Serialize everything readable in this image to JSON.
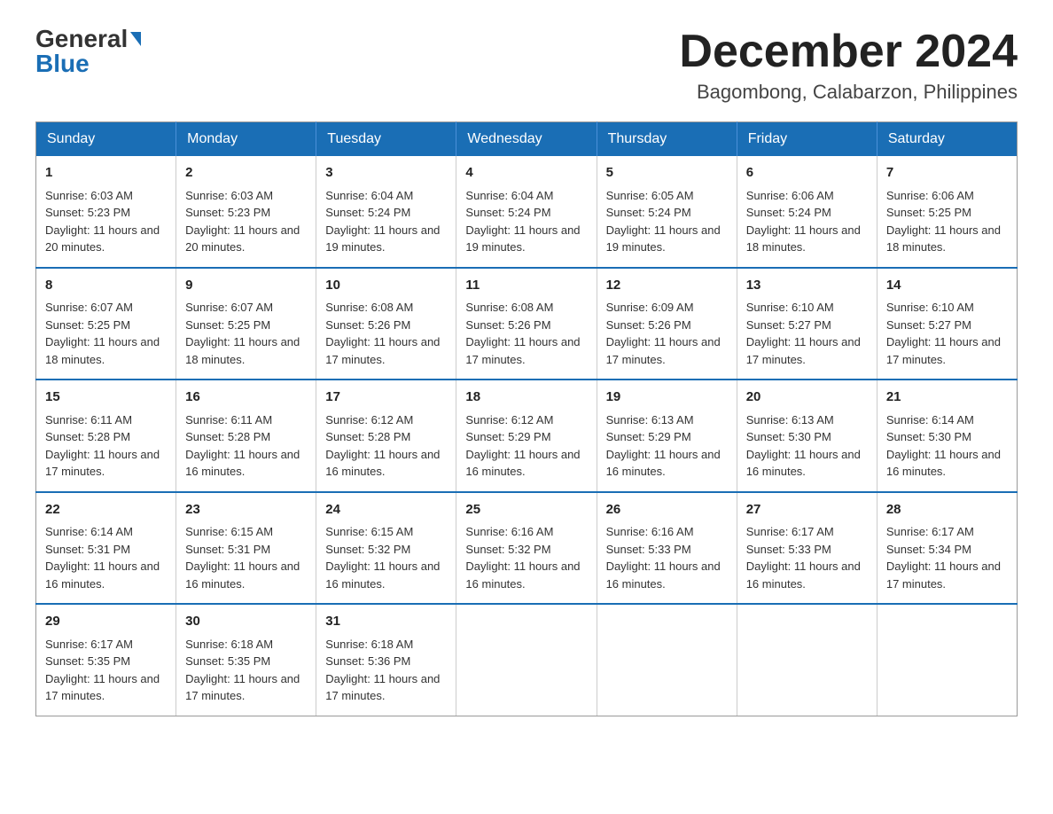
{
  "header": {
    "logo_general": "General",
    "logo_blue": "Blue",
    "month_title": "December 2024",
    "location": "Bagombong, Calabarzon, Philippines"
  },
  "days_of_week": [
    "Sunday",
    "Monday",
    "Tuesday",
    "Wednesday",
    "Thursday",
    "Friday",
    "Saturday"
  ],
  "weeks": [
    [
      {
        "day": "1",
        "sunrise": "6:03 AM",
        "sunset": "5:23 PM",
        "daylight": "11 hours and 20 minutes."
      },
      {
        "day": "2",
        "sunrise": "6:03 AM",
        "sunset": "5:23 PM",
        "daylight": "11 hours and 20 minutes."
      },
      {
        "day": "3",
        "sunrise": "6:04 AM",
        "sunset": "5:24 PM",
        "daylight": "11 hours and 19 minutes."
      },
      {
        "day": "4",
        "sunrise": "6:04 AM",
        "sunset": "5:24 PM",
        "daylight": "11 hours and 19 minutes."
      },
      {
        "day": "5",
        "sunrise": "6:05 AM",
        "sunset": "5:24 PM",
        "daylight": "11 hours and 19 minutes."
      },
      {
        "day": "6",
        "sunrise": "6:06 AM",
        "sunset": "5:24 PM",
        "daylight": "11 hours and 18 minutes."
      },
      {
        "day": "7",
        "sunrise": "6:06 AM",
        "sunset": "5:25 PM",
        "daylight": "11 hours and 18 minutes."
      }
    ],
    [
      {
        "day": "8",
        "sunrise": "6:07 AM",
        "sunset": "5:25 PM",
        "daylight": "11 hours and 18 minutes."
      },
      {
        "day": "9",
        "sunrise": "6:07 AM",
        "sunset": "5:25 PM",
        "daylight": "11 hours and 18 minutes."
      },
      {
        "day": "10",
        "sunrise": "6:08 AM",
        "sunset": "5:26 PM",
        "daylight": "11 hours and 17 minutes."
      },
      {
        "day": "11",
        "sunrise": "6:08 AM",
        "sunset": "5:26 PM",
        "daylight": "11 hours and 17 minutes."
      },
      {
        "day": "12",
        "sunrise": "6:09 AM",
        "sunset": "5:26 PM",
        "daylight": "11 hours and 17 minutes."
      },
      {
        "day": "13",
        "sunrise": "6:10 AM",
        "sunset": "5:27 PM",
        "daylight": "11 hours and 17 minutes."
      },
      {
        "day": "14",
        "sunrise": "6:10 AM",
        "sunset": "5:27 PM",
        "daylight": "11 hours and 17 minutes."
      }
    ],
    [
      {
        "day": "15",
        "sunrise": "6:11 AM",
        "sunset": "5:28 PM",
        "daylight": "11 hours and 17 minutes."
      },
      {
        "day": "16",
        "sunrise": "6:11 AM",
        "sunset": "5:28 PM",
        "daylight": "11 hours and 16 minutes."
      },
      {
        "day": "17",
        "sunrise": "6:12 AM",
        "sunset": "5:28 PM",
        "daylight": "11 hours and 16 minutes."
      },
      {
        "day": "18",
        "sunrise": "6:12 AM",
        "sunset": "5:29 PM",
        "daylight": "11 hours and 16 minutes."
      },
      {
        "day": "19",
        "sunrise": "6:13 AM",
        "sunset": "5:29 PM",
        "daylight": "11 hours and 16 minutes."
      },
      {
        "day": "20",
        "sunrise": "6:13 AM",
        "sunset": "5:30 PM",
        "daylight": "11 hours and 16 minutes."
      },
      {
        "day": "21",
        "sunrise": "6:14 AM",
        "sunset": "5:30 PM",
        "daylight": "11 hours and 16 minutes."
      }
    ],
    [
      {
        "day": "22",
        "sunrise": "6:14 AM",
        "sunset": "5:31 PM",
        "daylight": "11 hours and 16 minutes."
      },
      {
        "day": "23",
        "sunrise": "6:15 AM",
        "sunset": "5:31 PM",
        "daylight": "11 hours and 16 minutes."
      },
      {
        "day": "24",
        "sunrise": "6:15 AM",
        "sunset": "5:32 PM",
        "daylight": "11 hours and 16 minutes."
      },
      {
        "day": "25",
        "sunrise": "6:16 AM",
        "sunset": "5:32 PM",
        "daylight": "11 hours and 16 minutes."
      },
      {
        "day": "26",
        "sunrise": "6:16 AM",
        "sunset": "5:33 PM",
        "daylight": "11 hours and 16 minutes."
      },
      {
        "day": "27",
        "sunrise": "6:17 AM",
        "sunset": "5:33 PM",
        "daylight": "11 hours and 16 minutes."
      },
      {
        "day": "28",
        "sunrise": "6:17 AM",
        "sunset": "5:34 PM",
        "daylight": "11 hours and 17 minutes."
      }
    ],
    [
      {
        "day": "29",
        "sunrise": "6:17 AM",
        "sunset": "5:35 PM",
        "daylight": "11 hours and 17 minutes."
      },
      {
        "day": "30",
        "sunrise": "6:18 AM",
        "sunset": "5:35 PM",
        "daylight": "11 hours and 17 minutes."
      },
      {
        "day": "31",
        "sunrise": "6:18 AM",
        "sunset": "5:36 PM",
        "daylight": "11 hours and 17 minutes."
      },
      null,
      null,
      null,
      null
    ]
  ]
}
